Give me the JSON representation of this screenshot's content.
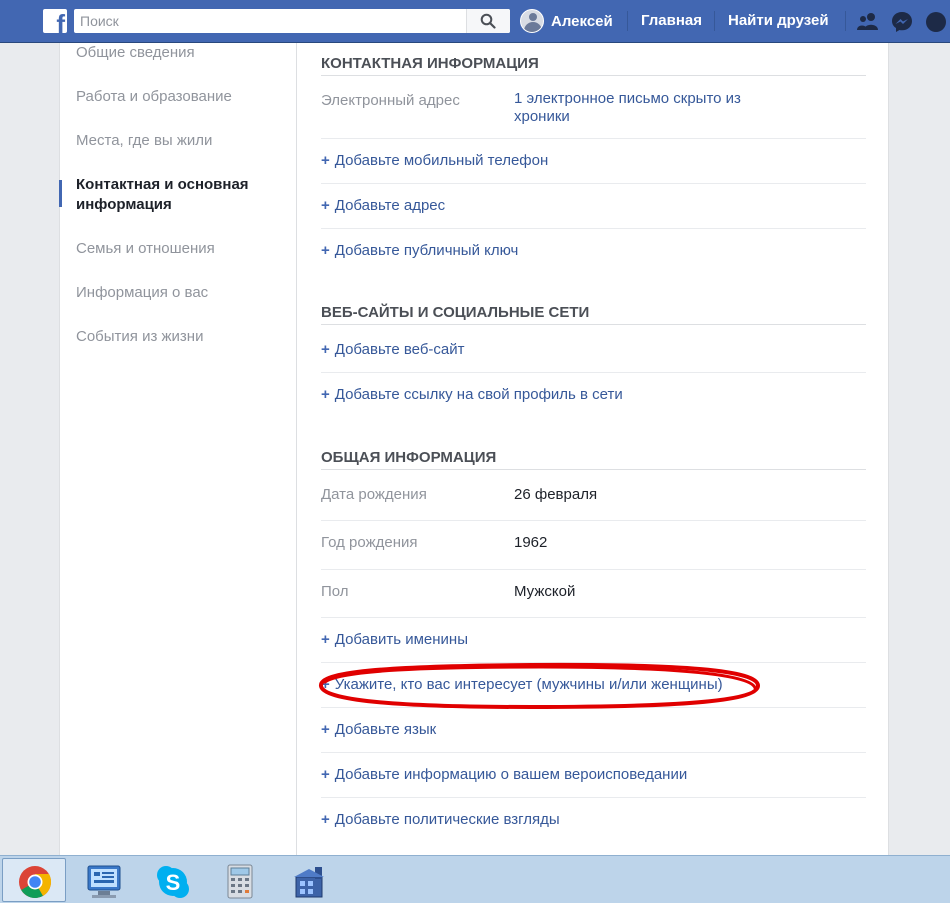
{
  "topbar": {
    "search_placeholder": "Поиск",
    "user_name": "Алексей",
    "home_label": "Главная",
    "find_friends_label": "Найти друзей"
  },
  "sidebar": {
    "items": [
      {
        "label": "Общие сведения",
        "active": false
      },
      {
        "label": "Работа и образование",
        "active": false
      },
      {
        "label": "Места, где вы жили",
        "active": false
      },
      {
        "label": "Контактная и основная информация",
        "active": true
      },
      {
        "label": "Семья и отношения",
        "active": false
      },
      {
        "label": "Информация о вас",
        "active": false
      },
      {
        "label": "События из жизни",
        "active": false
      }
    ]
  },
  "contact": {
    "title": "КОНТАКТНАЯ ИНФОРМАЦИЯ",
    "email_label": "Электронный адрес",
    "email_value": "1 электронное письмо скрыто из хроники",
    "add_phone": "Добавьте мобильный телефон",
    "add_address": "Добавьте адрес",
    "add_key": "Добавьте публичный ключ"
  },
  "websites": {
    "title": "ВЕБ-САЙТЫ И СОЦИАЛЬНЫЕ СЕТИ",
    "add_website": "Добавьте веб-сайт",
    "add_profile_link": "Добавьте ссылку на свой профиль в сети"
  },
  "general": {
    "title": "ОБЩАЯ ИНФОРМАЦИЯ",
    "birthday_label": "Дата рождения",
    "birthday_value": "26 февраля",
    "birthyear_label": "Год рождения",
    "birthyear_value": "1962",
    "gender_label": "Пол",
    "gender_value": "Мужской",
    "add_nameday": "Добавить именины",
    "add_interested_in": "Укажите, кто вас интересует (мужчины и/или женщины)",
    "add_language": "Добавьте язык",
    "add_religion": "Добавьте информацию о вашем вероисповедании",
    "add_political": "Добавьте политические взгляды"
  },
  "taskbar": {
    "apps": [
      "chrome-icon",
      "control-panel-icon",
      "skype-icon",
      "calculator-icon",
      "network-app-icon"
    ]
  },
  "colors": {
    "topbar": "#4267b2",
    "link": "#365899",
    "highlight_ellipse": "#e00000",
    "taskbar": "#bdd4ea"
  }
}
